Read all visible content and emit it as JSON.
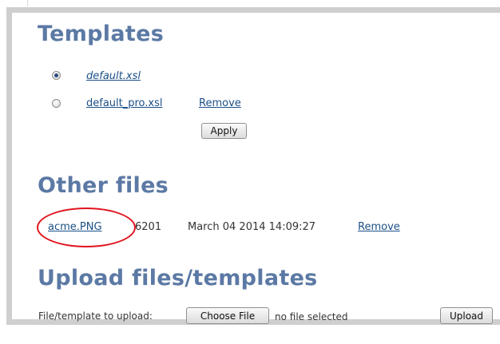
{
  "templates": {
    "title": "Templates",
    "items": [
      {
        "name": "default.xsl",
        "selected": true
      },
      {
        "name": "default_pro.xsl",
        "selected": false,
        "remove_label": "Remove"
      }
    ],
    "apply_label": "Apply"
  },
  "other_files": {
    "title": "Other files",
    "files": [
      {
        "name": "acme.PNG",
        "size": "6201",
        "date": "March 04 2014 14:09:27",
        "remove_label": "Remove"
      }
    ]
  },
  "upload": {
    "title": "Upload files/templates",
    "label": "File/template to upload:",
    "choose_label": "Choose File",
    "no_file_text": "no file selected",
    "upload_label": "Upload"
  },
  "colors": {
    "heading": "#5b79a4",
    "link": "#1a4f86",
    "highlight": "#e0141e"
  }
}
